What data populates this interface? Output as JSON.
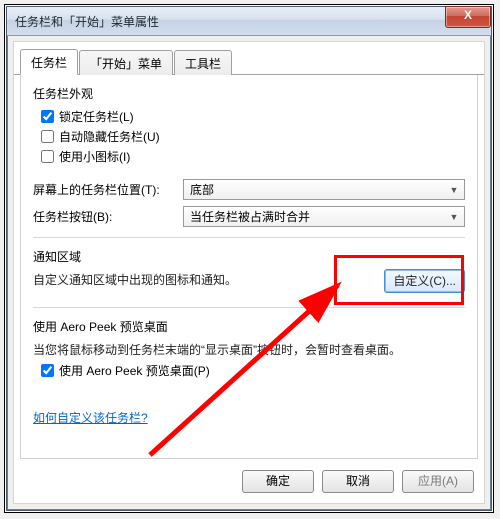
{
  "window": {
    "title": "任务栏和「开始」菜单属性",
    "close_label": "X"
  },
  "tabs": {
    "taskbar": "任务栏",
    "start_menu": "「开始」菜单",
    "toolbars": "工具栏"
  },
  "appearance": {
    "title": "任务栏外观",
    "lock": "锁定任务栏(L)",
    "autohide": "自动隐藏任务栏(U)",
    "small_icons": "使用小图标(I)"
  },
  "position": {
    "label": "屏幕上的任务栏位置(T):",
    "value": "底部"
  },
  "buttons": {
    "label": "任务栏按钮(B):",
    "value": "当任务栏被占满时合并"
  },
  "notification": {
    "title": "通知区域",
    "desc": "自定义通知区域中出现的图标和通知。",
    "customize_btn": "自定义(C)..."
  },
  "aero_peek": {
    "title": "使用 Aero Peek 预览桌面",
    "desc": "当您将鼠标移动到任务栏末端的“显示桌面”按钮时，会暂时查看桌面。",
    "checkbox": "使用 Aero Peek 预览桌面(P)"
  },
  "help_link": "如何自定义该任务栏?",
  "buttons_bar": {
    "ok": "确定",
    "cancel": "取消",
    "apply": "应用(A)"
  }
}
